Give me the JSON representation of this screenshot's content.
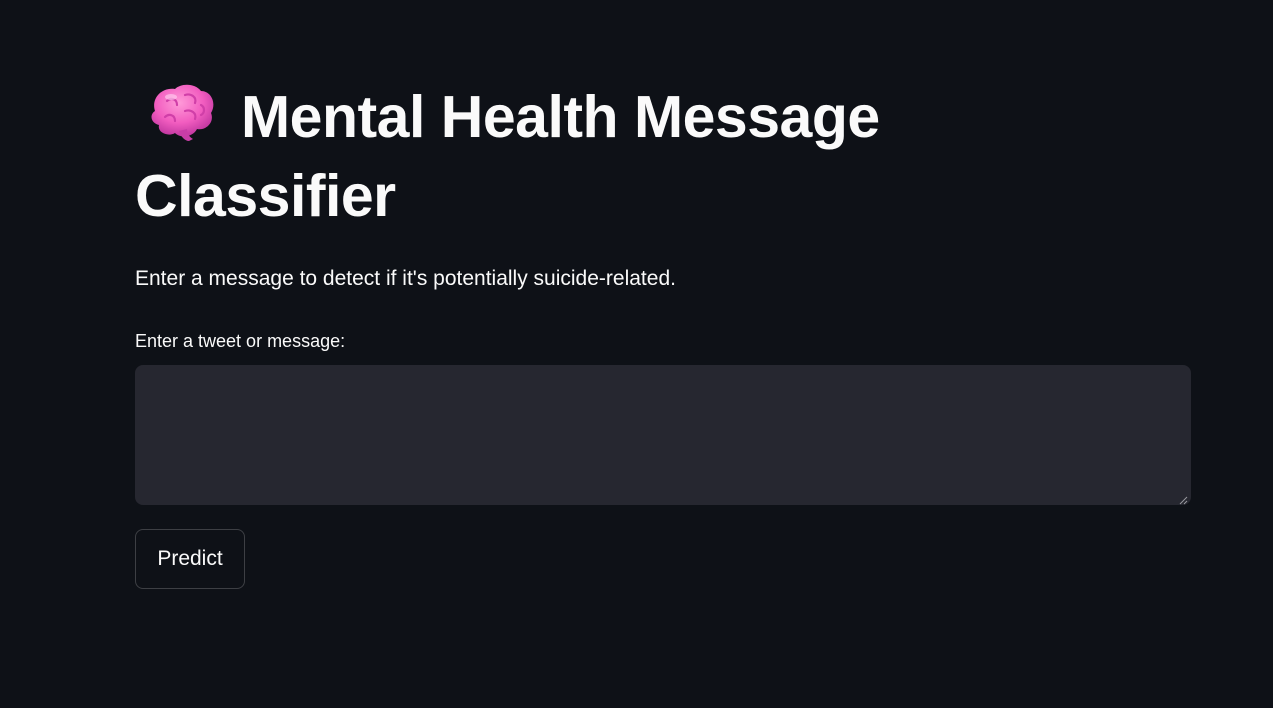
{
  "header": {
    "icon": "brain-icon",
    "title": "Mental Health Message Classifier"
  },
  "intro": {
    "text": "Enter a message to detect if it's potentially suicide-related."
  },
  "message_input": {
    "label": "Enter a tweet or message:",
    "value": "",
    "placeholder": ""
  },
  "actions": {
    "predict_label": "Predict"
  },
  "colors": {
    "background": "#0e1117",
    "input_background": "#262730",
    "text": "#fafafa"
  }
}
